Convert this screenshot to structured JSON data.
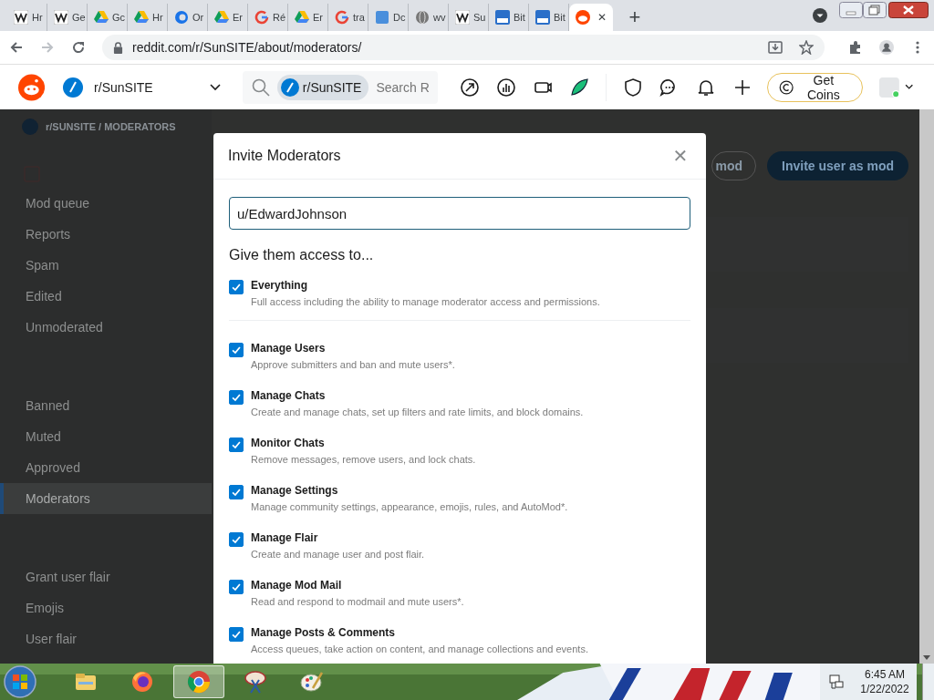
{
  "browser": {
    "tabs": [
      {
        "label": "Hr",
        "kind": "wiki",
        "selected": false
      },
      {
        "label": "Ge",
        "kind": "wiki",
        "selected": false
      },
      {
        "label": "Gc",
        "kind": "drive",
        "selected": false
      },
      {
        "label": "Hr",
        "kind": "drive",
        "selected": false
      },
      {
        "label": "Or",
        "kind": "swirl",
        "selected": false
      },
      {
        "label": "Er",
        "kind": "drive",
        "selected": false
      },
      {
        "label": "Ré",
        "kind": "google",
        "selected": false
      },
      {
        "label": "Er",
        "kind": "drive",
        "selected": false
      },
      {
        "label": "tra",
        "kind": "google",
        "selected": false
      },
      {
        "label": "Dc",
        "kind": "square",
        "selected": false
      },
      {
        "label": "wv",
        "kind": "globe",
        "selected": false
      },
      {
        "label": "Su",
        "kind": "wiki",
        "selected": false
      },
      {
        "label": "Bit",
        "kind": "bit",
        "selected": false
      },
      {
        "label": "Bit",
        "kind": "bit",
        "selected": false
      },
      {
        "kind": "reddit",
        "selected": true
      }
    ],
    "close_tab": "✕",
    "new_tab": "+",
    "url": "reddit.com/r/SunSITE/about/moderators/"
  },
  "header": {
    "community": "r/SunSITE",
    "search_chip": "r/SunSITE",
    "search_placeholder": "Search R",
    "get_coins": "Get Coins"
  },
  "background": {
    "breadcrumb": "r/SUNSITE / MODERATORS",
    "sidebar": [
      {
        "label": "Mod queue",
        "selected": false
      },
      {
        "label": "Reports",
        "selected": false
      },
      {
        "label": "Spam",
        "selected": false
      },
      {
        "label": "Edited",
        "selected": false
      },
      {
        "label": "Unmoderated",
        "selected": false
      },
      {
        "label": "Banned",
        "selected": false
      },
      {
        "label": "Muted",
        "selected": false
      },
      {
        "label": "Approved",
        "selected": false
      },
      {
        "label": "Moderators",
        "selected": true
      },
      {
        "label": "Grant user flair",
        "selected": false
      },
      {
        "label": "Emojis",
        "selected": false
      },
      {
        "label": "User flair",
        "selected": false
      }
    ],
    "buttons": [
      "mod",
      "Invite user as mod"
    ]
  },
  "modal": {
    "title": "Invite Moderators",
    "close": "✕",
    "username": "u/EdwardJohnson",
    "access_heading": "Give them access to...",
    "everything": {
      "label": "Everything",
      "description": "Full access including the ability to manage moderator access and permissions.",
      "checked": true
    },
    "permissions": [
      {
        "label": "Manage Users",
        "description": "Approve submitters and ban and mute users*.",
        "checked": true
      },
      {
        "label": "Manage Chats",
        "description": "Create and manage chats, set up filters and rate limits, and block domains.",
        "checked": true
      },
      {
        "label": "Monitor Chats",
        "description": "Remove messages, remove users, and lock chats.",
        "checked": true
      },
      {
        "label": "Manage Settings",
        "description": "Manage community settings, appearance, emojis, rules, and AutoMod*.",
        "checked": true
      },
      {
        "label": "Manage Flair",
        "description": "Create and manage user and post flair.",
        "checked": true
      },
      {
        "label": "Manage Mod Mail",
        "description": "Read and respond to modmail and mute users*.",
        "checked": true
      },
      {
        "label": "Manage Posts & Comments",
        "description": "Access queues, take action on content, and manage collections and events.",
        "checked": true
      }
    ]
  },
  "taskbar": {
    "apps": [
      {
        "kind": "explorer",
        "selected": false
      },
      {
        "kind": "firefox",
        "selected": false
      },
      {
        "kind": "chrome",
        "selected": true
      },
      {
        "kind": "snip",
        "selected": false
      },
      {
        "kind": "paint",
        "selected": false
      }
    ],
    "time": "6:45 AM",
    "date": "1/22/2022"
  }
}
